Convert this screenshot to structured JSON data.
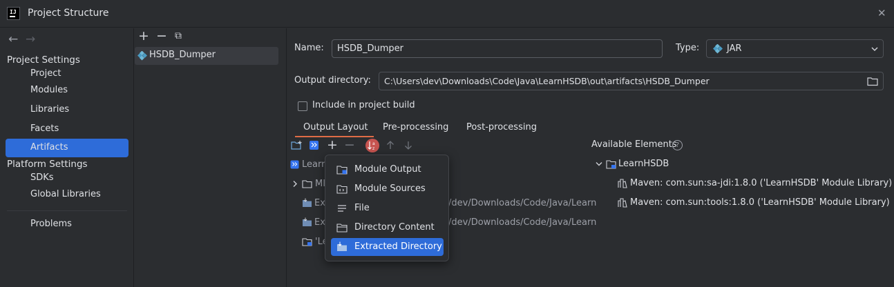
{
  "window": {
    "title": "Project Structure",
    "close_glyph": "✕"
  },
  "nav": {
    "back_glyph": "←",
    "forward_glyph": "→",
    "project_settings_header": "Project Settings",
    "project_settings": [
      "Project",
      "Modules",
      "Libraries",
      "Facets",
      "Artifacts"
    ],
    "platform_settings_header": "Platform Settings",
    "platform_settings": [
      "SDKs",
      "Global Libraries"
    ],
    "problems": "Problems",
    "selected": "Artifacts"
  },
  "artifact_list": {
    "toolbar": {
      "add": "+",
      "remove": "−",
      "copy": "⧉"
    },
    "items": [
      "HSDB_Dumper"
    ]
  },
  "detail": {
    "name_label": "Name:",
    "name_value": "HSDB_Dumper",
    "type_label": "Type:",
    "type_value": "JAR",
    "output_dir_label": "Output directory:",
    "output_dir_value": "C:\\Users\\dev\\Downloads\\Code\\Java\\LearnHSDB\\out\\artifacts\\HSDB_Dumper",
    "include_build_label": "Include in project build",
    "include_build_checked": false,
    "tabs": [
      "Output Layout",
      "Pre-processing",
      "Post-processing"
    ],
    "active_tab": "Output Layout"
  },
  "layout_tree": {
    "rows": [
      {
        "label": "Learn",
        "icon": "jar-icon"
      },
      {
        "label": "MI",
        "icon": "folder-icon",
        "expandable": true
      },
      {
        "label": "Ex",
        "suffix": "/dev/Downloads/Code/Java/Learn",
        "icon": "extracted-icon"
      },
      {
        "label": "Ex",
        "suffix": "/dev/Downloads/Code/Java/Learn",
        "icon": "extracted-icon"
      },
      {
        "label": "'Le",
        "icon": "module-output-icon"
      }
    ]
  },
  "add_menu": {
    "items": [
      "Module Output",
      "Module Sources",
      "File",
      "Directory Content",
      "Extracted Directory"
    ],
    "selected": "Extracted Directory"
  },
  "available": {
    "header": "Available Elements",
    "help_glyph": "?",
    "tree": [
      {
        "label": "LearnHSDB",
        "expanded": true
      },
      {
        "label": "Maven: com.sun:sa-jdi:1.8.0 ('LearnHSDB' Module Library)"
      },
      {
        "label": "Maven: com.sun:tools:1.8.0 ('LearnHSDB' Module Library)"
      }
    ]
  },
  "colors": {
    "accent": "#2e6cd9",
    "background": "#2b2d30",
    "border": "#1e1f22",
    "tab_underline": "#e06c46",
    "sort_icon_bg": "#c75450"
  }
}
